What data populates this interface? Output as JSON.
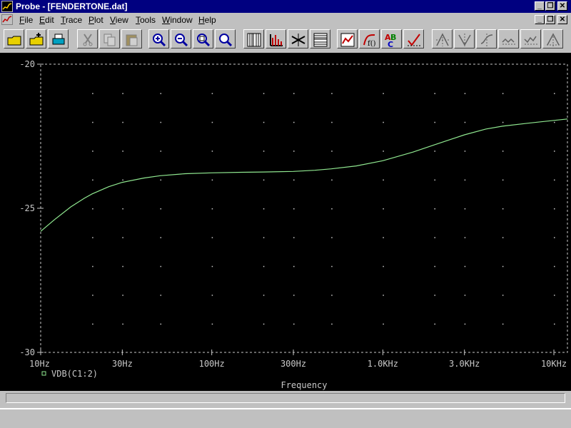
{
  "window": {
    "title": "Probe - [FENDERTONE.dat]",
    "app_buttons": {
      "minimize": "_",
      "restore": "❐",
      "close": "✕"
    },
    "doc_buttons": {
      "minimize": "_",
      "restore": "❐",
      "close": "✕"
    }
  },
  "menu": [
    {
      "label": "File",
      "u": "F",
      "rest": "ile"
    },
    {
      "label": "Edit",
      "u": "E",
      "rest": "dit"
    },
    {
      "label": "Trace",
      "u": "T",
      "rest": "race"
    },
    {
      "label": "Plot",
      "u": "P",
      "rest": "lot"
    },
    {
      "label": "View",
      "u": "V",
      "rest": "iew"
    },
    {
      "label": "Tools",
      "u": "T",
      "rest": "ools"
    },
    {
      "label": "Window",
      "u": "W",
      "rest": "indow"
    },
    {
      "label": "Help",
      "u": "H",
      "rest": "elp"
    }
  ],
  "toolbar": [
    "open-folder-icon",
    "append-file-icon",
    "print-icon",
    "cut-icon",
    "copy-icon",
    "paste-icon",
    "zoom-in-icon",
    "zoom-out-icon",
    "zoom-area-icon",
    "zoom-fit-icon",
    "log-x-axis-icon",
    "fourier-icon",
    "performance-analysis-icon",
    "log-y-axis-icon",
    "add-trace-icon",
    "eval-function-icon",
    "label-text-icon",
    "mark-data-icon",
    "toggle-cursor-icon",
    "cursor-peak-icon",
    "cursor-trough-icon",
    "cursor-slope-icon",
    "cursor-min-icon",
    "cursor-max-icon",
    "cursor-point-icon"
  ],
  "colors": {
    "plot_bg": "#000000",
    "trace": "#90e890",
    "axis": "#c8c8c8",
    "titlebar": "#000080"
  },
  "chart_data": {
    "type": "line",
    "title": "",
    "xlabel": "Frequency",
    "ylabel": "",
    "x_scale": "log",
    "xlim": [
      10,
      12000
    ],
    "ylim": [
      -30,
      -20
    ],
    "x_ticks": [
      {
        "value": 10,
        "label": "10Hz"
      },
      {
        "value": 30,
        "label": "30Hz"
      },
      {
        "value": 100,
        "label": "100Hz"
      },
      {
        "value": 300,
        "label": "300Hz"
      },
      {
        "value": 1000,
        "label": "1.0KHz"
      },
      {
        "value": 3000,
        "label": "3.0KHz"
      },
      {
        "value": 10000,
        "label": "10KHz"
      }
    ],
    "y_ticks": [
      {
        "value": -20,
        "label": "-20"
      },
      {
        "value": -25,
        "label": "-25"
      },
      {
        "value": -30,
        "label": "-30"
      }
    ],
    "grid": "dotted",
    "legend": "bottom-left",
    "series": [
      {
        "name": "VDB(C1:2)",
        "x": [
          10,
          12,
          15,
          18,
          20,
          25,
          30,
          40,
          50,
          70,
          100,
          150,
          200,
          300,
          400,
          500,
          700,
          1000,
          1500,
          2000,
          3000,
          4000,
          5000,
          7000,
          10000,
          12000
        ],
        "y": [
          -25.8,
          -25.4,
          -24.95,
          -24.65,
          -24.5,
          -24.25,
          -24.1,
          -23.95,
          -23.87,
          -23.8,
          -23.77,
          -23.75,
          -23.74,
          -23.72,
          -23.68,
          -23.63,
          -23.53,
          -23.35,
          -23.05,
          -22.8,
          -22.45,
          -22.25,
          -22.15,
          -22.05,
          -21.95,
          -21.9
        ]
      }
    ]
  }
}
